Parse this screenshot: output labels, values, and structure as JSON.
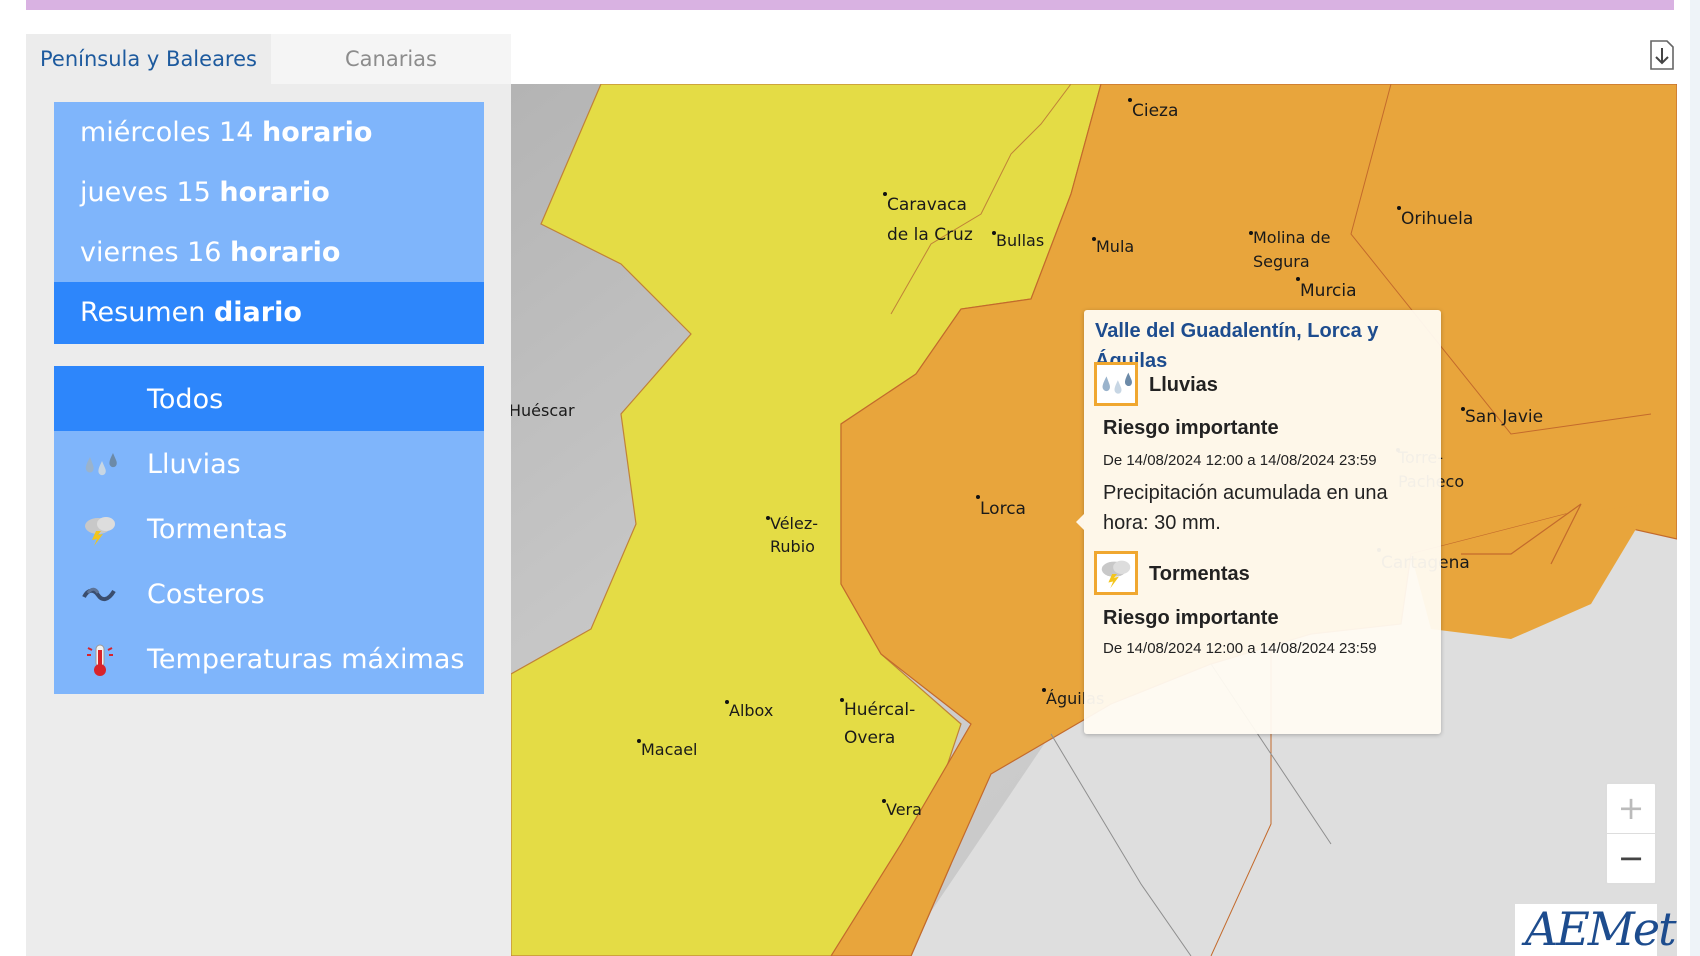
{
  "tabs": [
    "Península y Baleares",
    "Canarias"
  ],
  "days": [
    {
      "prefix": "miércoles 14 ",
      "bold": "horario"
    },
    {
      "prefix": "jueves 15 ",
      "bold": "horario"
    },
    {
      "prefix": "viernes 16 ",
      "bold": "horario"
    },
    {
      "prefix": "Resumen ",
      "bold": "diario"
    }
  ],
  "active_day_index": 3,
  "categories": [
    {
      "label": "Todos",
      "icon": "none"
    },
    {
      "label": "Lluvias",
      "icon": "rain-drops-icon"
    },
    {
      "label": "Tormentas",
      "icon": "storm-cloud-icon"
    },
    {
      "label": "Costeros",
      "icon": "waves-icon"
    },
    {
      "label": "Temperaturas máximas",
      "icon": "thermometer-icon"
    }
  ],
  "active_category_index": 0,
  "colors": {
    "yellow_warning": "#e4dc45",
    "orange_warning": "#e8a53c",
    "button": "#7fb5fb",
    "button_active": "#2d86fb",
    "popup_title": "#1d4c8e"
  },
  "places": [
    "Cieza",
    "Caravaca\nde la Cruz",
    "Bullas",
    "Mula",
    "Molina de\nSegura",
    "Murcia",
    "Orihuela",
    "Huéscar",
    "San Javie",
    "Torre-\nPacheco",
    "Vélez-\nRubio",
    "Lorca",
    "Cartagena",
    "Albox",
    "Huércal-\nOvera",
    "Águilas",
    "Macael",
    "Vera"
  ],
  "popup": {
    "title": "Valle del Guadalentín, Lorca y Águilas",
    "warnings": [
      {
        "name": "Lluvias",
        "icon": "rain-drops-icon",
        "risk": "Riesgo importante",
        "dates": "De 14/08/2024 12:00 a 14/08/2024 23:59",
        "description": "Precipitación acumulada en una hora: 30 mm."
      },
      {
        "name": "Tormentas",
        "icon": "storm-cloud-icon",
        "risk": "Riesgo importante",
        "dates": "De 14/08/2024 12:00 a 14/08/2024 23:59"
      }
    ]
  },
  "zoom": {
    "in": "+",
    "out": "−"
  },
  "logo_text": "AEMet"
}
